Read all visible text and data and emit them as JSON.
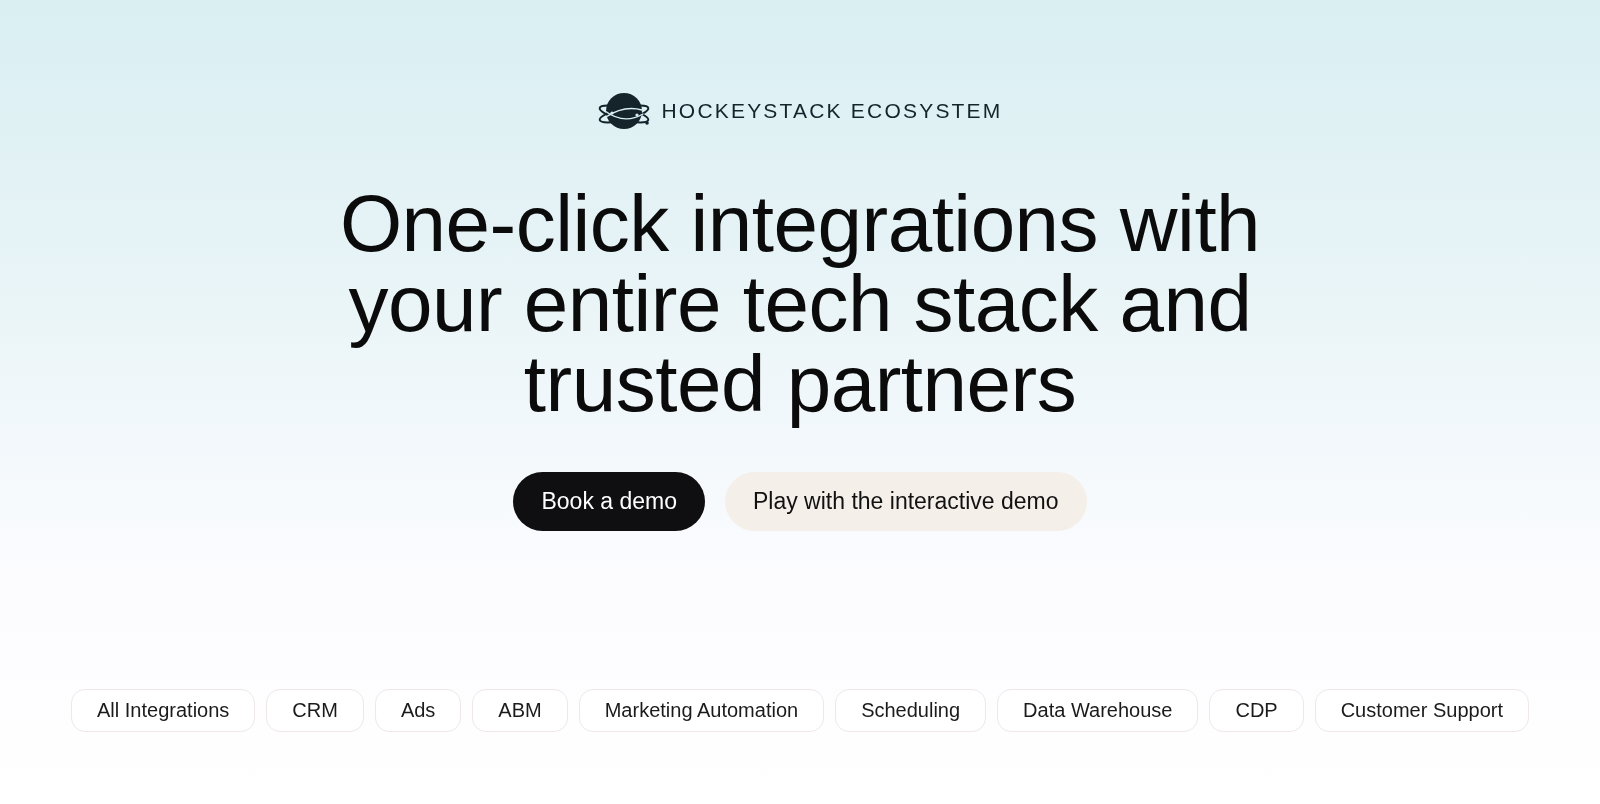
{
  "brand": {
    "name": "HOCKEYSTACK ECOSYSTEM"
  },
  "headline": "One-click integrations with your entire tech stack and trusted partners",
  "buttons": [
    {
      "label": "Book a demo",
      "kind": "primary"
    },
    {
      "label": "Play with the interactive demo",
      "kind": "secondary"
    }
  ],
  "categories": [
    {
      "label": "All Integrations",
      "selected": false
    },
    {
      "label": "CRM",
      "selected": false
    },
    {
      "label": "Ads",
      "selected": false
    },
    {
      "label": "ABM",
      "selected": false
    },
    {
      "label": "Marketing Automation",
      "selected": false
    },
    {
      "label": "Scheduling",
      "selected": false
    },
    {
      "label": "Data Warehouse",
      "selected": false
    },
    {
      "label": "CDP",
      "selected": false
    },
    {
      "label": "Customer Support",
      "selected": false
    }
  ]
}
